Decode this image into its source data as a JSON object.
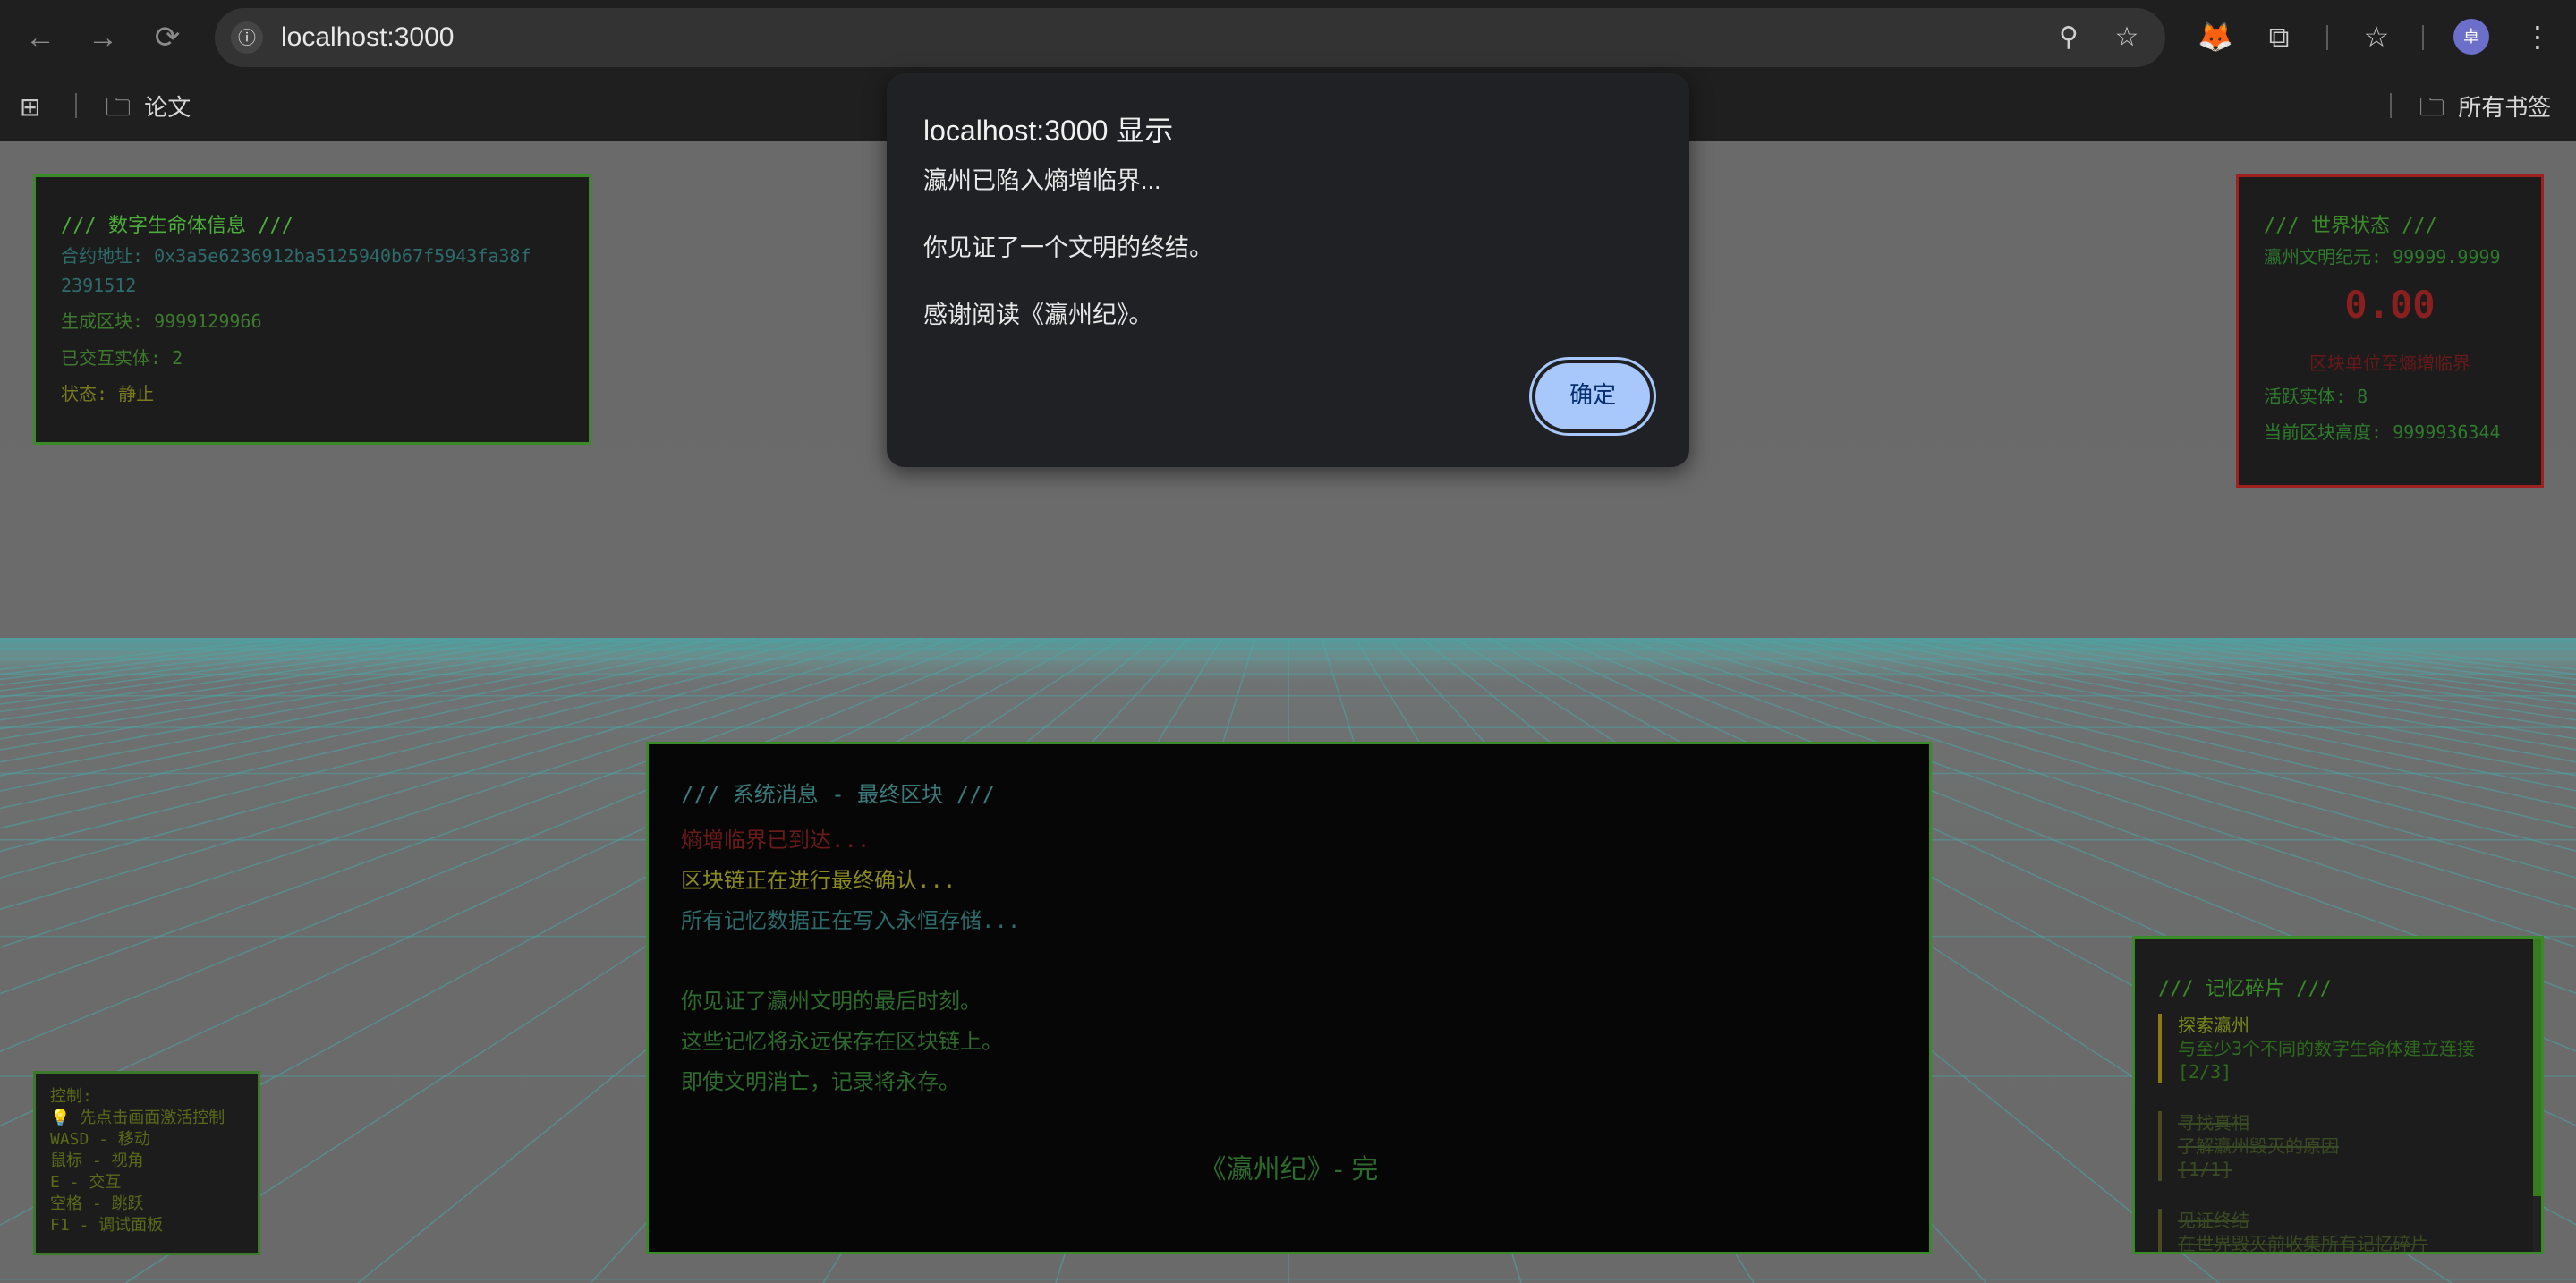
{
  "browser": {
    "url": "localhost:3000",
    "back_icon": "←",
    "forward_icon": "→",
    "reload_icon": "⟳",
    "site_info_icon": "ⓘ",
    "zoom_icon": "⚲",
    "star_icon": "☆",
    "extension_fox_icon": "🦊",
    "puzzle_icon": "⧉",
    "bookmark_star_icon": "☆",
    "avatar_letter": "卓",
    "menu_icon": "⋮",
    "apps_icon": "⊞",
    "bookmark_folder_label": "论文",
    "all_bookmarks_label": "所有书签",
    "folder_icon": "🗀"
  },
  "info_panel": {
    "header": "/// 数字生命体信息 ///",
    "contract_label": "合约地址: 0x3a5e6236912ba5125940b67f5943fa38f",
    "contract_label_cont": "2391512",
    "block_label": "生成区块: 9999129966",
    "interacted_label": "已交互实体: 2",
    "status_label": "状态: 静止"
  },
  "world_panel": {
    "header": "/// 世界状态 ///",
    "era_label": "瀛州文明纪元: 99999.9999",
    "value": "0.00",
    "subtitle": "区块单位至熵增临界",
    "active_label": "活跃实体: 8",
    "height_label": "当前区块高度: 9999936344"
  },
  "system_panel": {
    "header": "/// 系统消息 - 最终区块 ///",
    "lines": [
      "熵增临界已到达...",
      "区块链正在进行最终确认...",
      "所有记忆数据正在写入永恒存储...",
      "你见证了瀛州文明的最后时刻。",
      "这些记忆将永远保存在区块链上。",
      "即使文明消亡，记录将永存。"
    ],
    "ending": "《瀛州纪》- 完"
  },
  "controls_panel": {
    "lines": [
      "控制:",
      "💡 先点击画面激活控制",
      "WASD - 移动",
      "鼠标 - 视角",
      "E - 交互",
      "空格 - 跳跃",
      "F1 - 调试面板"
    ]
  },
  "memory_panel": {
    "header": "/// 记忆碎片 ///",
    "items": [
      {
        "title": "探索瀛州",
        "desc": "与至少3个不同的数字生命体建立连接",
        "progress": "[2/3]"
      },
      {
        "title": "寻找真相",
        "desc": "了解瀛州毁灭的原因",
        "progress": "[1/1]"
      },
      {
        "title": "见证终结",
        "desc": "在世界毁灭前收集所有记忆碎片",
        "progress": ""
      }
    ]
  },
  "dialog": {
    "title": "localhost:3000 显示",
    "line1": "瀛州已陷入熵增临界...",
    "line2": "你见证了一个文明的终结。",
    "line3": "感谢阅读《瀛州纪》。",
    "ok_label": "确定"
  },
  "colors": {
    "alert_red": "#8a1f1f",
    "terminal_green": "#3a8a2a",
    "button_blue": "#a8c7fa"
  }
}
